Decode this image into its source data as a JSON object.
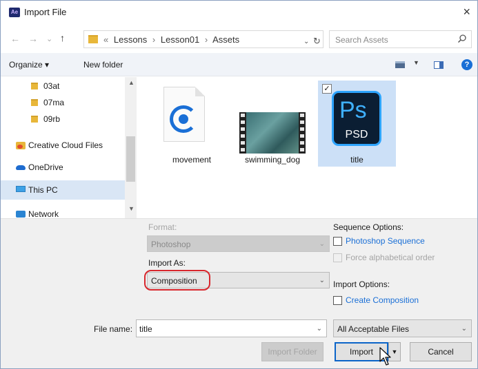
{
  "window": {
    "title": "Import File",
    "app_icon_text": "Ae",
    "close_glyph": "×"
  },
  "nav": {
    "back_glyph": "←",
    "forward_glyph": "→",
    "recent_glyph": "⌄",
    "up_glyph": "↑"
  },
  "address": {
    "overflow": "«",
    "segments": [
      "Lessons",
      "Lesson01",
      "Assets"
    ],
    "separator": "›",
    "dropdown_glyph": "⌄",
    "refresh_glyph": "↻"
  },
  "search": {
    "placeholder": "Search Assets",
    "icon": "search-icon"
  },
  "toolbar": {
    "organize_label": "Organize ▾",
    "new_folder_label": "New folder",
    "help_glyph": "?"
  },
  "sidebar": {
    "items": [
      {
        "label": "03at",
        "icon": "folder-icon"
      },
      {
        "label": "07ma",
        "icon": "folder-icon"
      },
      {
        "label": "09rb",
        "icon": "folder-icon"
      },
      {
        "label": "Creative Cloud Files",
        "icon": "creative-cloud-folder-icon"
      },
      {
        "label": "OneDrive",
        "icon": "onedrive-icon"
      },
      {
        "label": "This PC",
        "icon": "this-pc-icon",
        "selected": true
      },
      {
        "label": "Network",
        "icon": "network-icon"
      }
    ]
  },
  "files": [
    {
      "name": "movement",
      "icon": "motion-file-icon"
    },
    {
      "name": "swimming_dog",
      "icon": "video-file-icon"
    },
    {
      "name": "title",
      "icon": "photoshop-file-icon",
      "icon_text": "Ps",
      "ext_text": "PSD",
      "selected": true,
      "checked": "✓"
    }
  ],
  "options": {
    "format_label": "Format:",
    "format_value": "Photoshop",
    "import_as_label": "Import As:",
    "import_as_value": "Composition",
    "sequence_label": "Sequence Options:",
    "photoshop_sequence": "Photoshop Sequence",
    "force_alpha": "Force alphabetical order",
    "import_options_label": "Import Options:",
    "create_composition": "Create Composition"
  },
  "footer": {
    "filename_label": "File name:",
    "filename_value": "title",
    "filter_value": "All Acceptable Files",
    "import_folder_label": "Import Folder",
    "import_label": "Import",
    "cancel_label": "Cancel"
  },
  "colors": {
    "accent": "#1a6fd6",
    "highlight_oval": "#d8262c",
    "selected_bg": "#cce0f7"
  }
}
